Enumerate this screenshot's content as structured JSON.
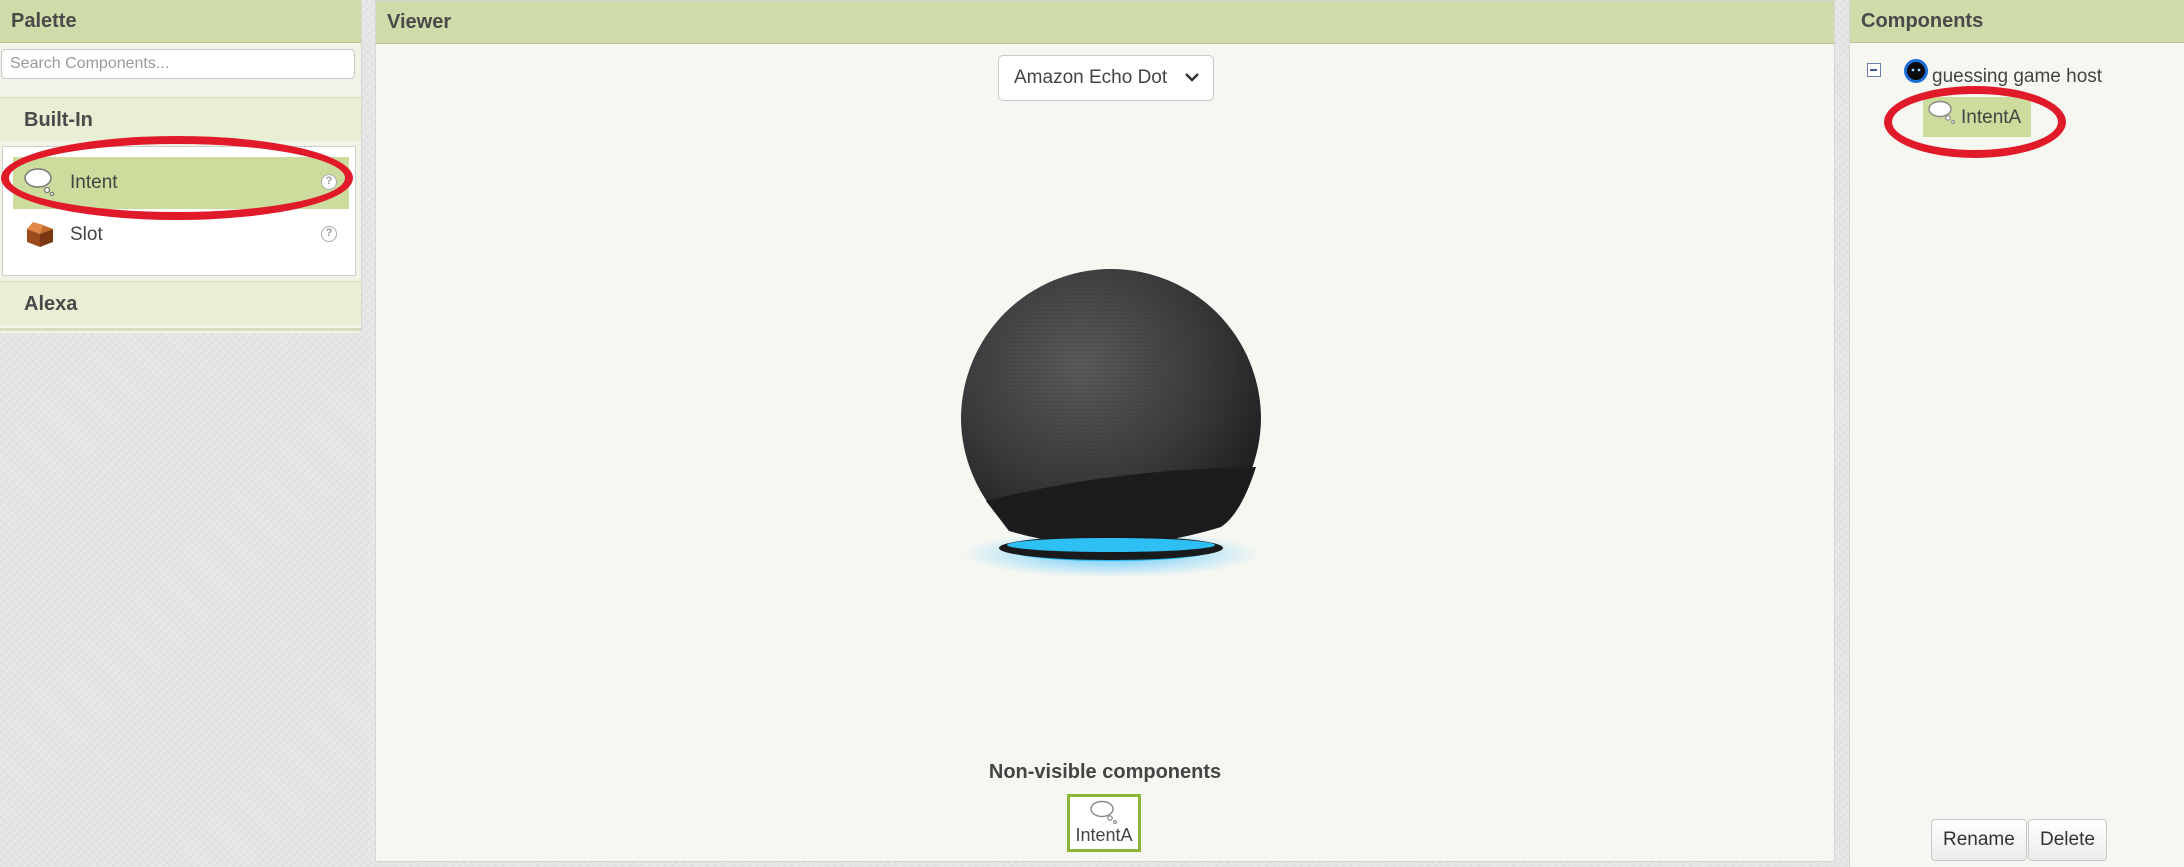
{
  "palette": {
    "title": "Palette",
    "search_placeholder": "Search Components...",
    "categories": [
      {
        "title": "Built-In",
        "items": [
          {
            "label": "Intent",
            "icon": "speech-bubble-icon",
            "selected": true,
            "help": "?"
          },
          {
            "label": "Slot",
            "icon": "box-icon",
            "selected": false,
            "help": "?"
          }
        ]
      },
      {
        "title": "Alexa"
      }
    ]
  },
  "viewer": {
    "title": "Viewer",
    "device_selected": "Amazon Echo Dot",
    "device_image": "amazon-echo-dot-image",
    "non_visible_title": "Non-visible components",
    "non_visible_items": [
      {
        "label": "IntentA",
        "icon": "speech-bubble-icon"
      }
    ]
  },
  "components": {
    "title": "Components",
    "root": {
      "label": "guessing game host",
      "icon": "alexa-icon"
    },
    "children": [
      {
        "label": "IntentA",
        "icon": "speech-bubble-icon"
      }
    ],
    "rename_label": "Rename",
    "delete_label": "Delete"
  },
  "colors": {
    "header_bg": "#cfdcaa",
    "selection": "#cbdc9c",
    "highlight_ring": "#e11a2a",
    "nonvisible_border": "#8cb636"
  }
}
